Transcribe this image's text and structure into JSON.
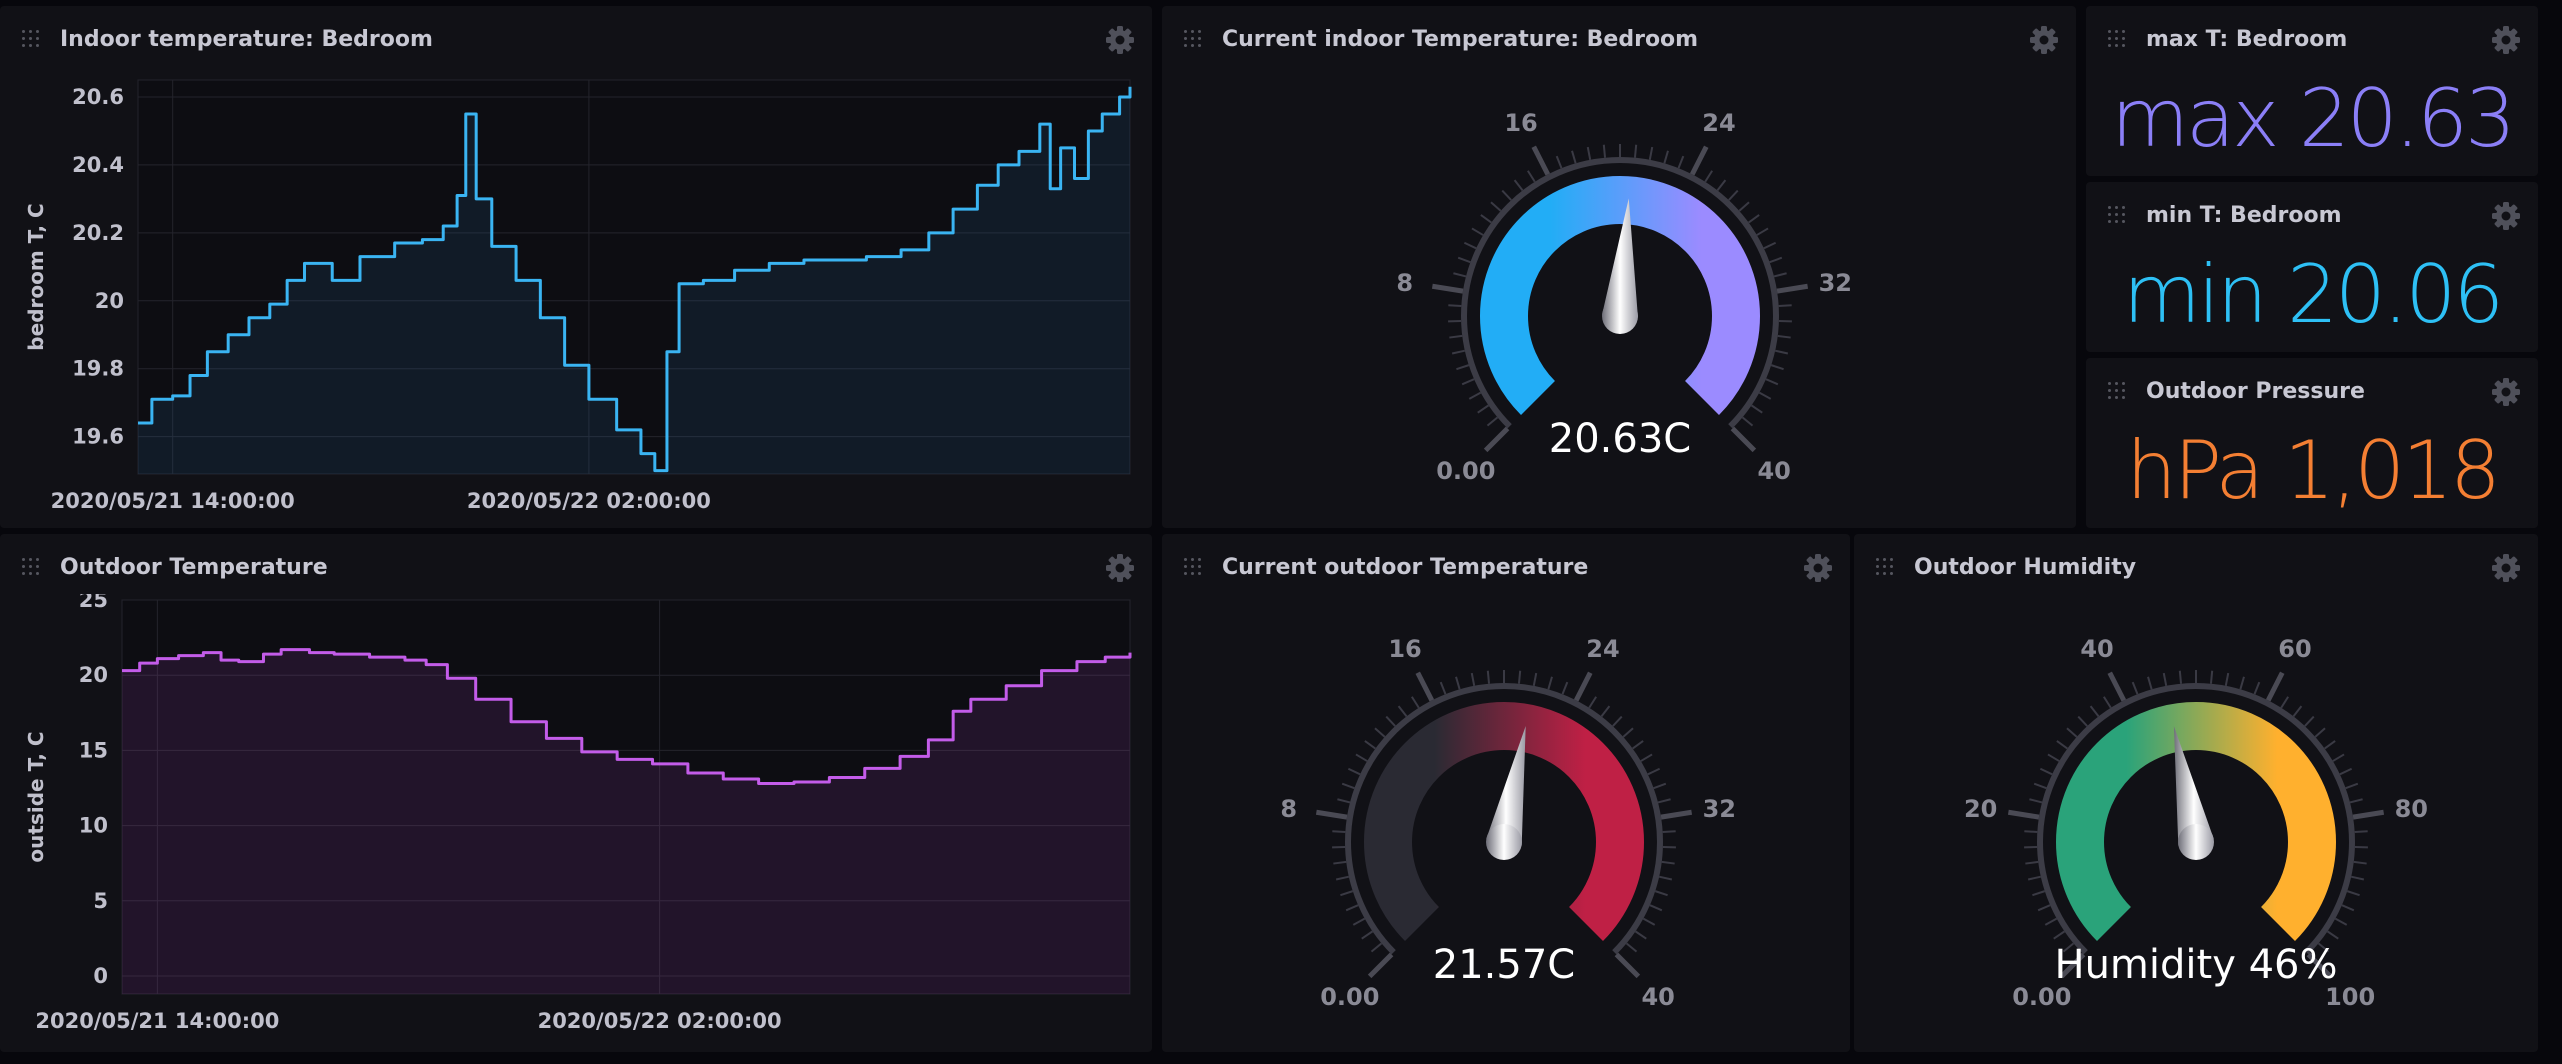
{
  "cells": {
    "indoor_chart": {
      "title": "Indoor temperature: Bedroom"
    },
    "indoor_gauge": {
      "title": "Current indoor Temperature: Bedroom"
    },
    "max_stat": {
      "title": "max T: Bedroom",
      "value": "max 20.63"
    },
    "min_stat": {
      "title": "min T: Bedroom",
      "value": "min 20.06"
    },
    "pressure_stat": {
      "title": "Outdoor Pressure",
      "value": "hPa 1,018"
    },
    "outdoor_chart": {
      "title": "Outdoor Temperature"
    },
    "outdoor_gauge": {
      "title": "Current outdoor Temperature"
    },
    "humidity_gauge": {
      "title": "Outdoor Humidity"
    }
  },
  "icons": {
    "drag": "drag-handle-icon",
    "settings": "gear-icon"
  },
  "colors": {
    "indoor_line": "#3ab4f2",
    "outdoor_line": "#c35ce9",
    "max_stat": "#8b7ff7",
    "min_stat": "#2ec0f5",
    "pressure_stat": "#f47f33"
  },
  "chart_data": [
    {
      "type": "line",
      "series": [
        {
          "values": [
            [
              0,
              19.64
            ],
            [
              0.4,
              19.71
            ],
            [
              1.0,
              19.72
            ],
            [
              1.5,
              19.78
            ],
            [
              2.0,
              19.85
            ],
            [
              2.6,
              19.9
            ],
            [
              3.2,
              19.95
            ],
            [
              3.8,
              19.99
            ],
            [
              4.3,
              20.06
            ],
            [
              4.8,
              20.11
            ],
            [
              5.6,
              20.06
            ],
            [
              6.4,
              20.13
            ],
            [
              7.4,
              20.17
            ],
            [
              8.2,
              20.18
            ],
            [
              8.8,
              20.22
            ],
            [
              9.2,
              20.31
            ],
            [
              9.45,
              20.55
            ],
            [
              9.75,
              20.3
            ],
            [
              10.2,
              20.16
            ],
            [
              10.9,
              20.06
            ],
            [
              11.6,
              19.95
            ],
            [
              12.3,
              19.81
            ],
            [
              13.0,
              19.71
            ],
            [
              13.8,
              19.62
            ],
            [
              14.5,
              19.55
            ],
            [
              14.9,
              19.5
            ],
            [
              15.25,
              19.85
            ],
            [
              15.6,
              20.05
            ],
            [
              16.3,
              20.06
            ],
            [
              17.2,
              20.09
            ],
            [
              18.2,
              20.11
            ],
            [
              19.2,
              20.12
            ],
            [
              20.2,
              20.12
            ],
            [
              21.0,
              20.13
            ],
            [
              22.0,
              20.15
            ],
            [
              22.8,
              20.2
            ],
            [
              23.5,
              20.27
            ],
            [
              24.2,
              20.34
            ],
            [
              24.8,
              20.4
            ],
            [
              25.4,
              20.44
            ],
            [
              26.0,
              20.52
            ],
            [
              26.3,
              20.33
            ],
            [
              26.6,
              20.45
            ],
            [
              27.0,
              20.36
            ],
            [
              27.4,
              20.5
            ],
            [
              27.8,
              20.55
            ],
            [
              28.3,
              20.6
            ],
            [
              28.6,
              20.63
            ]
          ]
        }
      ],
      "xlabel": "",
      "ylabel": "bedroom T, C",
      "xlim": [
        0,
        28.6
      ],
      "ylim": [
        19.49,
        20.65
      ],
      "xticks": [
        {
          "x": 1,
          "label": "2020/05/21 14:00:00"
        },
        {
          "x": 13,
          "label": "2020/05/22 02:00:00"
        }
      ],
      "yticks": [
        19.6,
        19.8,
        20,
        20.2,
        20.4,
        20.6
      ],
      "grid": true
    },
    {
      "type": "area",
      "series": [
        {
          "values": [
            [
              0,
              20.3
            ],
            [
              0.5,
              20.8
            ],
            [
              1.0,
              21.1
            ],
            [
              1.6,
              21.3
            ],
            [
              2.3,
              21.5
            ],
            [
              2.8,
              21.0
            ],
            [
              3.3,
              20.9
            ],
            [
              4.0,
              21.4
            ],
            [
              4.5,
              21.7
            ],
            [
              5.3,
              21.5
            ],
            [
              6.0,
              21.4
            ],
            [
              7.0,
              21.2
            ],
            [
              8.0,
              21.0
            ],
            [
              8.6,
              20.7
            ],
            [
              9.2,
              19.8
            ],
            [
              10.0,
              18.4
            ],
            [
              11.0,
              16.9
            ],
            [
              12.0,
              15.8
            ],
            [
              13.0,
              14.9
            ],
            [
              14.0,
              14.4
            ],
            [
              15.0,
              14.1
            ],
            [
              16.0,
              13.5
            ],
            [
              17.0,
              13.1
            ],
            [
              18.0,
              12.8
            ],
            [
              19.0,
              12.9
            ],
            [
              20.0,
              13.2
            ],
            [
              21.0,
              13.8
            ],
            [
              22.0,
              14.6
            ],
            [
              22.8,
              15.7
            ],
            [
              23.5,
              17.6
            ],
            [
              24.0,
              18.4
            ],
            [
              25.0,
              19.3
            ],
            [
              26.0,
              20.3
            ],
            [
              27.0,
              20.9
            ],
            [
              27.8,
              21.2
            ],
            [
              28.5,
              21.5
            ]
          ]
        }
      ],
      "xlabel": "",
      "ylabel": "outside T, C",
      "xlim": [
        0,
        28.5
      ],
      "ylim": [
        -1.2,
        25
      ],
      "xticks": [
        {
          "x": 1,
          "label": "2020/05/21 14:00:00"
        },
        {
          "x": 15.2,
          "label": "2020/05/22 02:00:00"
        }
      ],
      "yticks": [
        0,
        5,
        10,
        15,
        20,
        25
      ],
      "grid": true
    }
  ],
  "gauges": [
    {
      "id": "indoor",
      "min": 0,
      "max": 40,
      "value": 20.63,
      "tick_labels": [
        "0.00",
        "8",
        "16",
        "24",
        "32",
        "40"
      ],
      "readout": "20.63C",
      "colors": [
        "#22adf6",
        "#9b8bff"
      ]
    },
    {
      "id": "outdoor",
      "min": 0,
      "max": 40,
      "value": 21.57,
      "tick_labels": [
        "0.00",
        "8",
        "16",
        "24",
        "32",
        "40"
      ],
      "readout": "21.57C",
      "colors": [
        "#2a2a33",
        "#bf2045"
      ]
    },
    {
      "id": "humidity",
      "min": 0,
      "max": 100,
      "value": 46,
      "tick_labels": [
        "0.00",
        "20",
        "40",
        "60",
        "80",
        "100"
      ],
      "readout": "Humidity 46%",
      "colors": [
        "#2aa37a",
        "#ffb02e"
      ]
    }
  ]
}
